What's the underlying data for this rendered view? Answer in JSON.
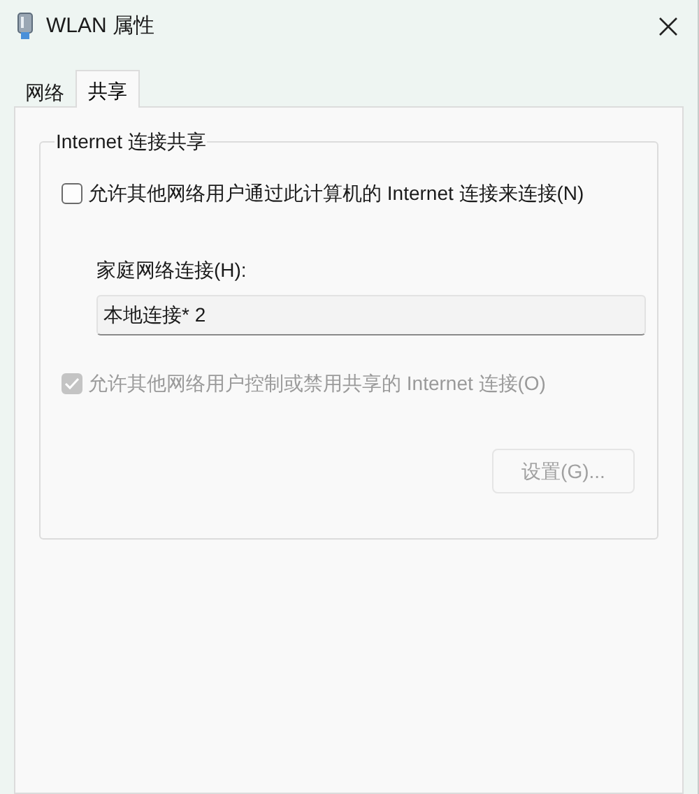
{
  "window": {
    "title": "WLAN 属性"
  },
  "tabs": [
    {
      "label": "网络",
      "selected": false
    },
    {
      "label": "共享",
      "selected": true
    }
  ],
  "group": {
    "title": "Internet 连接共享",
    "allow_sharing": {
      "label": "允许其他网络用户通过此计算机的 Internet 连接来连接(N)",
      "checked": false,
      "disabled": false
    },
    "home_network": {
      "label": "家庭网络连接(H):",
      "value": "本地连接* 2"
    },
    "allow_control": {
      "label": "允许其他网络用户控制或禁用共享的 Internet 连接(O)",
      "checked": true,
      "disabled": true
    },
    "settings_button": {
      "label": "设置(G)...",
      "disabled": true
    }
  }
}
